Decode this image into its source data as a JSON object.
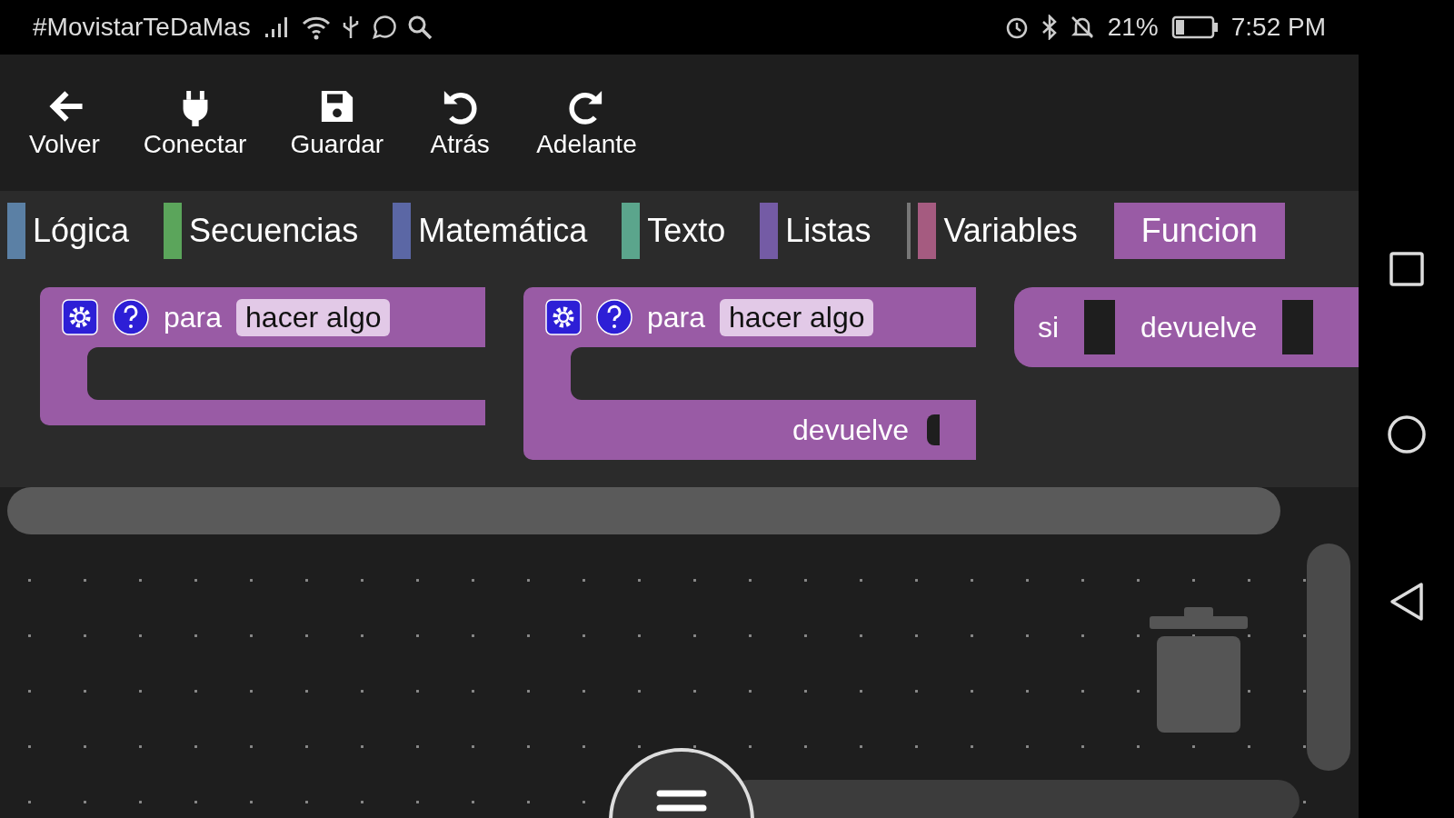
{
  "status_bar": {
    "carrier": "#MovistarTeDaMas",
    "battery": "21%",
    "time": "7:52 PM"
  },
  "toolbar": [
    {
      "kind": "back",
      "label": "Volver"
    },
    {
      "kind": "plug",
      "label": "Conectar"
    },
    {
      "kind": "save",
      "label": "Guardar"
    },
    {
      "kind": "undo",
      "label": "Atrás"
    },
    {
      "kind": "redo",
      "label": "Adelante"
    }
  ],
  "categories": [
    {
      "label": "Lógica",
      "color": "#5b80a5",
      "selected": false,
      "divider_before": false
    },
    {
      "label": "Secuencias",
      "color": "#5ba55b",
      "selected": false,
      "divider_before": false
    },
    {
      "label": "Matemática",
      "color": "#5b67a5",
      "selected": false,
      "divider_before": false
    },
    {
      "label": "Texto",
      "color": "#5ba58c",
      "selected": false,
      "divider_before": false
    },
    {
      "label": "Listas",
      "color": "#745ba5",
      "selected": false,
      "divider_before": false
    },
    {
      "label": "Variables",
      "color": "#a55b80",
      "selected": false,
      "divider_before": true
    },
    {
      "label": "Funcion",
      "color": "#995ba5",
      "selected": true,
      "divider_before": false
    }
  ],
  "flyout_blocks": [
    {
      "kind": "procedure",
      "keyword": "para",
      "field": "hacer algo"
    },
    {
      "kind": "procedure_return",
      "keyword": "para",
      "field": "hacer algo",
      "return_label": "devuelve"
    },
    {
      "kind": "if_return",
      "keyword": "si",
      "return_label": "devuelve"
    }
  ]
}
